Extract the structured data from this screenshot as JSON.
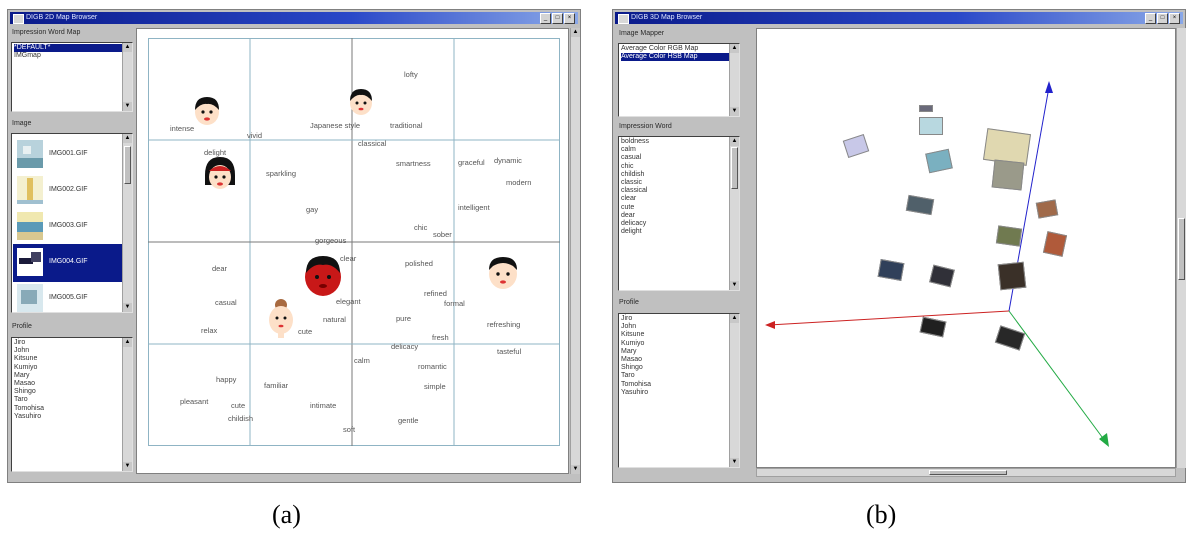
{
  "window_a": {
    "title": "DIGB 2D Map Browser",
    "impression_map_label": "Impression Word Map",
    "impression_maps": [
      "*DEFAULT*",
      "IMGmap"
    ],
    "image_label": "Image",
    "images": [
      "IMG001.GIF",
      "IMG002.GIF",
      "IMG003.GIF",
      "IMG004.GIF",
      "IMG005.GIF"
    ],
    "selected_image": "IMG004.GIF",
    "profile_label": "Profile",
    "profiles": [
      "Jiro",
      "John",
      "Kitsune",
      "Kumiyo",
      "Mary",
      "Masao",
      "Shingo",
      "Taro",
      "Tomohisa",
      "Yasuhiro"
    ],
    "words": [
      "lofty",
      "Japanese style",
      "traditional",
      "intense",
      "vivid",
      "classical",
      "delight",
      "sparkling",
      "smartness",
      "graceful",
      "dynamic",
      "modern",
      "gay",
      "intelligent",
      "chic",
      "gorgeous",
      "clear",
      "sober",
      "polished",
      "dear",
      "casual",
      "elegant",
      "refined",
      "formal",
      "relax",
      "natural",
      "pure",
      "cute",
      "refreshing",
      "delicacy",
      "fresh",
      "tasteful",
      "calm",
      "romantic",
      "happy",
      "familiar",
      "simple",
      "pleasant",
      "cute",
      "intimate",
      "gentle",
      "childish",
      "soft"
    ]
  },
  "window_b": {
    "title": "DIGB 3D Map Browser",
    "image_mapper_label": "Image Mapper",
    "image_mappers": [
      "Average Color RGB Map",
      "Average Color HSB Map"
    ],
    "selected_mapper": "Average Color HSB Map",
    "impression_word_label": "Impression Word",
    "impression_words": [
      "boldness",
      "calm",
      "casual",
      "chic",
      "childish",
      "classic",
      "classical",
      "clear",
      "cute",
      "dear",
      "delicacy",
      "delight"
    ],
    "profile_label": "Profile",
    "profiles": [
      "Jiro",
      "John",
      "Kitsune",
      "Kumiyo",
      "Mary",
      "Masao",
      "Shingo",
      "Taro",
      "Tomohisa",
      "Yasuhiro"
    ]
  },
  "captions": {
    "a": "(a)",
    "b": "(b)"
  },
  "colors": {
    "title_bar": "#0a1a8a",
    "selection": "#0a1a8a",
    "grid_line": "#8fb4c4",
    "axis_x": "#cc2222",
    "axis_y": "#2222cc",
    "axis_z": "#22aa44"
  }
}
